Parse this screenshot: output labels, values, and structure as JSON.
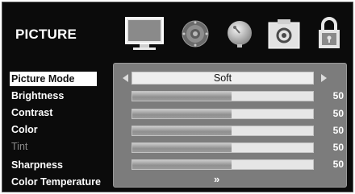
{
  "osd": {
    "title": "PICTURE",
    "tabs": [
      {
        "icon": "tv-picture-icon",
        "active": true
      },
      {
        "icon": "speaker-sound-icon",
        "active": false
      },
      {
        "icon": "satellite-channel-icon",
        "active": false
      },
      {
        "icon": "setup-settings-icon",
        "active": false
      },
      {
        "icon": "lock-icon",
        "active": false
      }
    ]
  },
  "menu": {
    "items": [
      {
        "label": "Picture Mode",
        "state": "selected"
      },
      {
        "label": "Brightness",
        "state": "normal"
      },
      {
        "label": "Contrast",
        "state": "normal"
      },
      {
        "label": "Color",
        "state": "normal"
      },
      {
        "label": "Tint",
        "state": "disabled"
      },
      {
        "label": "Sharpness",
        "state": "normal"
      },
      {
        "label": "Color Temperature",
        "state": "normal"
      }
    ]
  },
  "panel": {
    "picture_mode_value": "Soft",
    "sliders": [
      {
        "name": "Brightness",
        "value": "50",
        "level": 0.55
      },
      {
        "name": "Contrast",
        "value": "50",
        "level": 0.55
      },
      {
        "name": "Color",
        "value": "50",
        "level": 0.55
      },
      {
        "name": "Tint",
        "value": "50",
        "level": 0.55
      },
      {
        "name": "Sharpness",
        "value": "50",
        "level": 0.55
      }
    ],
    "more_glyph": "»"
  },
  "colors": {
    "background": "#0b0b0b",
    "panel": "#7c7c7c",
    "text": "#ffffff",
    "disabled_text": "#8a8a8a"
  }
}
